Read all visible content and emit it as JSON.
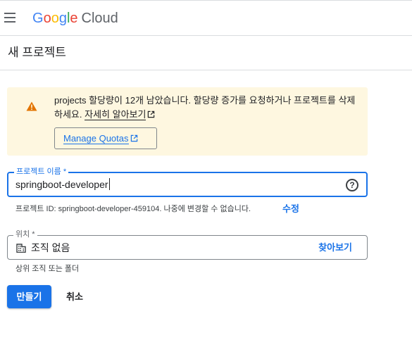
{
  "header": {
    "menu_icon": "hamburger-menu-icon",
    "logo_letters": [
      "G",
      "o",
      "o",
      "g",
      "l",
      "e"
    ],
    "logo_product": "Cloud"
  },
  "page": {
    "title": "새 프로젝트"
  },
  "quota_warning": {
    "icon": "warning-icon",
    "message": "projects 할당량이 12개 남았습니다. 할당량 증가를 요청하거나 프로젝트를 삭제하세요.",
    "learn_more": "자세히 알아보기",
    "manage_button": "Manage Quotas"
  },
  "project_name": {
    "label": "프로젝트 이름 *",
    "value": "springboot-developer",
    "help_icon": "help-circle-icon",
    "id_hint": "프로젝트 ID: springboot-developer-459104. 나중에 변경할 수 없습니다.",
    "edit_label": "수정"
  },
  "location": {
    "label": "위치 *",
    "icon": "organization-icon",
    "value": "조직 없음",
    "browse_label": "찾아보기",
    "hint": "상위 조직 또는 폴더"
  },
  "actions": {
    "create_label": "만들기",
    "cancel_label": "취소"
  },
  "colors": {
    "primary": "#1a73e8",
    "warning_bg": "#fef7e0",
    "warning_icon": "#e37400"
  }
}
